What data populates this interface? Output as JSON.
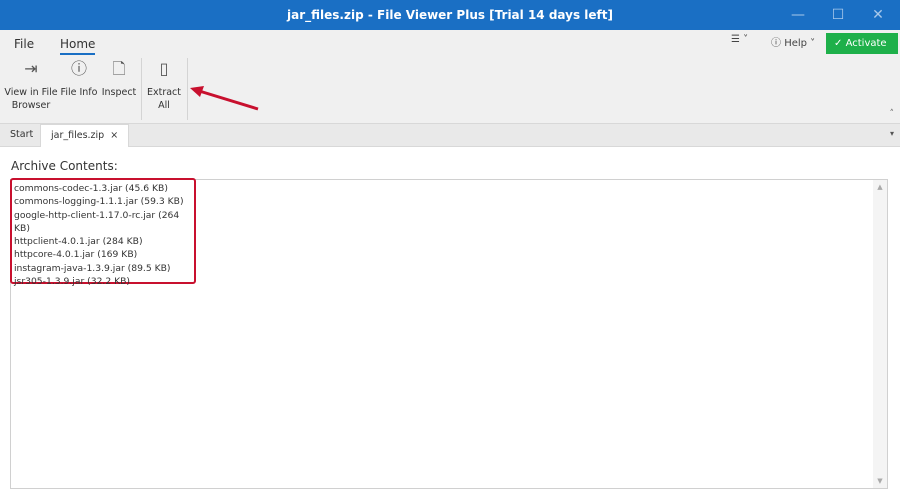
{
  "window": {
    "title": "jar_files.zip - File Viewer Plus [Trial 14 days left]"
  },
  "menu": {
    "file": "File",
    "home": "Home",
    "help": "Help",
    "activate": "Activate"
  },
  "ribbon": {
    "view_in_file_browser": "View in File Browser",
    "file_info": "File Info",
    "inspect": "Inspect",
    "extract_all": "Extract All"
  },
  "tabs": [
    {
      "label": "Start"
    },
    {
      "label": "jar_files.zip"
    }
  ],
  "main": {
    "label": "Archive Contents:",
    "files": [
      "commons-codec-1.3.jar (45.6 KB)",
      "commons-logging-1.1.1.jar (59.3 KB)",
      "google-http-client-1.17.0-rc.jar (264 KB)",
      "httpclient-4.0.1.jar (284 KB)",
      "httpcore-4.0.1.jar (169 KB)",
      "instagram-java-1.3.9.jar (89.5 KB)",
      "jsr305-1.3.9.jar (32.2 KB)"
    ]
  },
  "colors": {
    "titlebar": "#1a6fc4",
    "activate": "#1eb04a",
    "highlight": "#c8102e"
  }
}
